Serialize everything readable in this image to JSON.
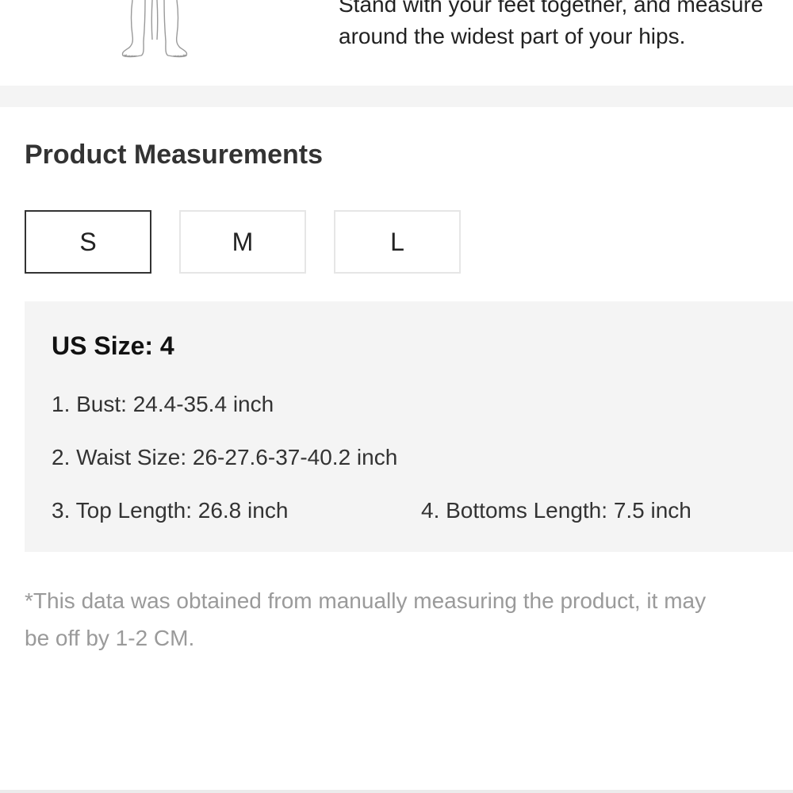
{
  "hip_instruction": {
    "line1": "Stand with your feet together, and measure",
    "line2": "around the widest part of your hips."
  },
  "product_measurements": {
    "title": "Product Measurements",
    "sizes": [
      "S",
      "M",
      "L"
    ],
    "selected_size": "S",
    "details": {
      "us_size": "US Size: 4",
      "bust": "1. Bust: 24.4-35.4 inch",
      "waist": "2. Waist Size: 26-27.6-37-40.2 inch",
      "top_length": "3. Top Length: 26.8 inch",
      "bottoms_length": "4. Bottoms Length: 7.5 inch"
    },
    "note": {
      "line1": "*This data was obtained from manually measuring the product, it may",
      "line2": "be off by 1-2 CM."
    }
  },
  "colors": {
    "panel_bg": "#f4f4f4",
    "active_border": "#333333",
    "inactive_border": "#e6e6e6",
    "note_text": "#9a9a9a"
  }
}
